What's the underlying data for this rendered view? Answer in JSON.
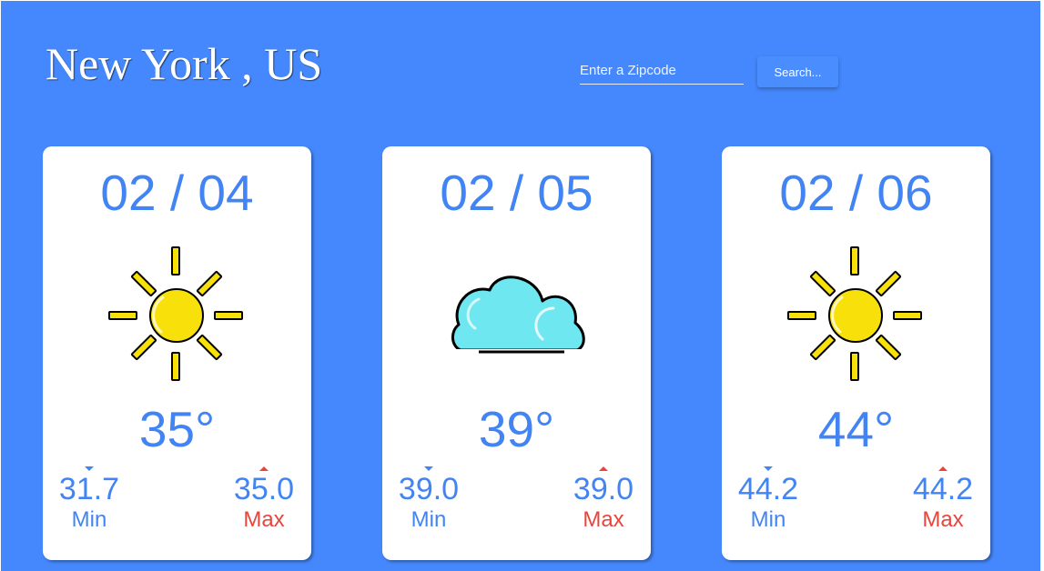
{
  "header": {
    "city_title": "New York , US",
    "zip_placeholder": "Enter a Zipcode",
    "zip_value": "",
    "search_label": "Search..."
  },
  "forecast": [
    {
      "date": "02 / 04",
      "icon": "sun-icon",
      "temp": "35°",
      "min": "31.7",
      "min_label": "Min",
      "max": "35.0",
      "max_label": "Max"
    },
    {
      "date": "02 / 05",
      "icon": "cloud-icon",
      "temp": "39°",
      "min": "39.0",
      "min_label": "Min",
      "max": "39.0",
      "max_label": "Max"
    },
    {
      "date": "02 / 06",
      "icon": "sun-icon",
      "temp": "44°",
      "min": "44.2",
      "min_label": "Min",
      "max": "44.2",
      "max_label": "Max"
    }
  ],
  "colors": {
    "background": "#4588fd",
    "accent_blue": "#4284f3",
    "max_red": "#e8453c",
    "sun_yellow": "#f8e00a",
    "cloud_cyan": "#6ee7f0"
  }
}
